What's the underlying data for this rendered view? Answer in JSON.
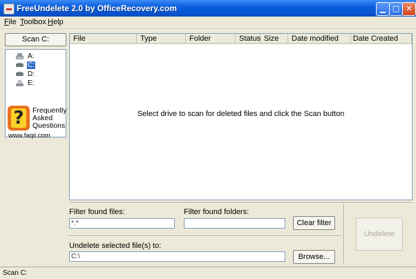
{
  "window": {
    "title": "FreeUndelete 2.0 by OfficeRecovery.com"
  },
  "menu": [
    {
      "label": "File",
      "u": "F",
      "rest": "ile"
    },
    {
      "label": "Toolbox",
      "u": "T",
      "rest": "oolbox"
    },
    {
      "label": "Help",
      "u": "H",
      "rest": "elp"
    }
  ],
  "sidebar": {
    "scan_button": "Scan C:",
    "drives": [
      "A:",
      "C:",
      "D:",
      "E:"
    ],
    "selected_drive": "C:"
  },
  "faq": {
    "icon_char": "?",
    "line1": "Frequently",
    "line2": "Asked",
    "line3": "Questions",
    "url": "www.faqii.com"
  },
  "columns": [
    "File",
    "Type",
    "Folder",
    "Status",
    "Size",
    "Date modified",
    "Date Created"
  ],
  "list": {
    "empty_message": "Select drive to scan for deleted files and click the Scan button"
  },
  "filters": {
    "files_label": "Filter found files:",
    "files_value": "*.*",
    "folders_label": "Filter found folders:",
    "folders_value": "",
    "clear_button": "Clear filter"
  },
  "undelete": {
    "target_label": "Undelete selected file(s) to:",
    "target_value": "C:\\",
    "browse_button": "Browse...",
    "undelete_button": "Undelete"
  },
  "status": {
    "text": "Scan C:"
  }
}
